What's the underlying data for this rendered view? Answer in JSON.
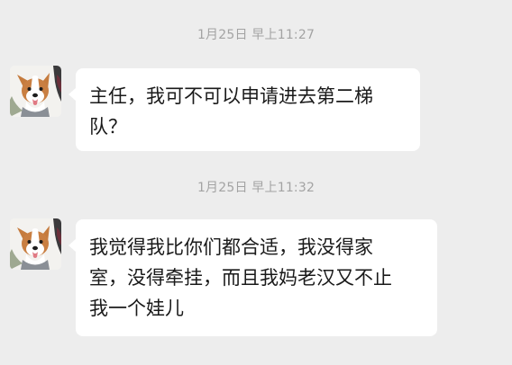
{
  "messages": [
    {
      "timestamp": "1月25日 早上11:27",
      "sender_avatar": "corgi-dog-avatar",
      "lines": [
        "主任，我可不可以申请进去第二梯",
        "队？"
      ]
    },
    {
      "timestamp": "1月25日 早上11:32",
      "sender_avatar": "corgi-dog-avatar",
      "lines": [
        "我觉得我比你们都合适，我没得家",
        "室，没得牵挂，而且我妈老汉又不止",
        "我一个娃儿"
      ]
    }
  ],
  "colors": {
    "background": "#ededed",
    "bubble": "#ffffff",
    "timestamp": "#a3a3a3",
    "text": "#1a1a1a"
  }
}
